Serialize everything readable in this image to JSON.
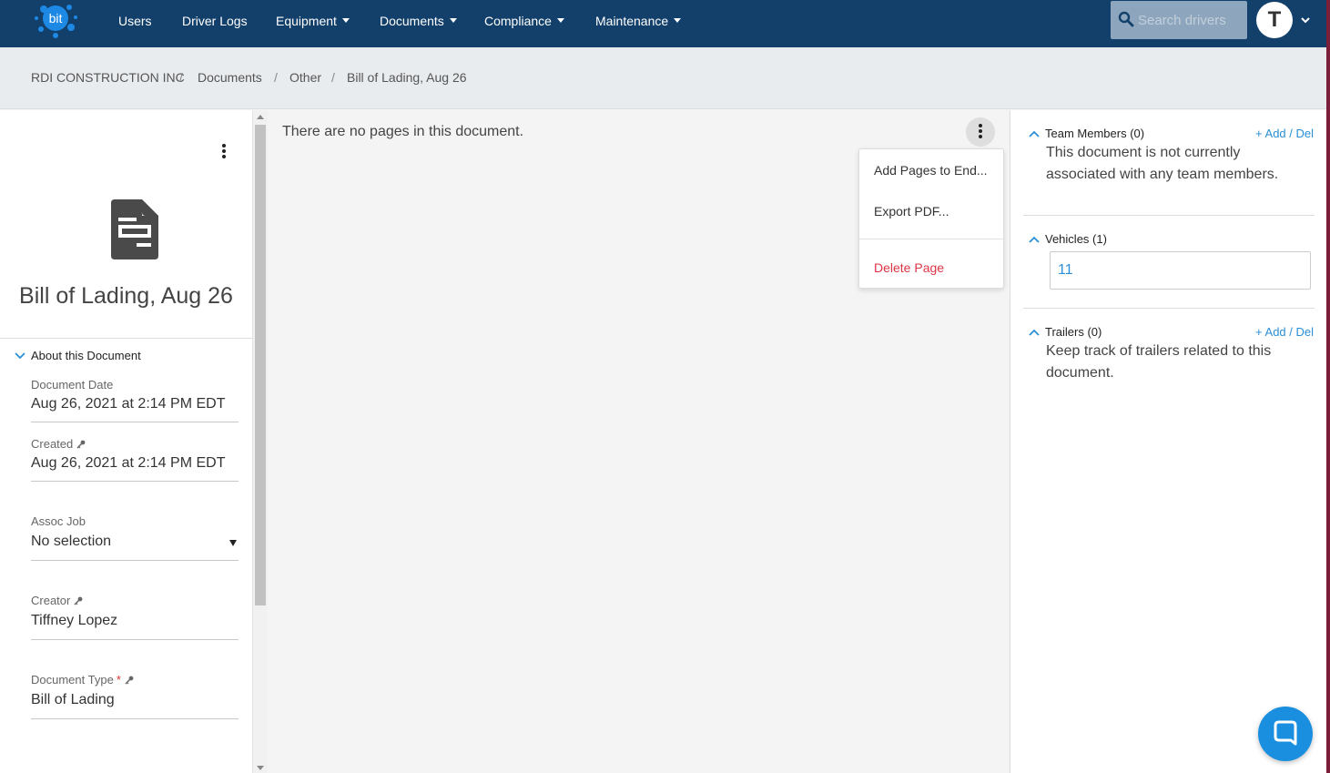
{
  "navbar": {
    "logo_text": "bit",
    "items": [
      {
        "label": "Users",
        "dropdown": false
      },
      {
        "label": "Driver Logs",
        "dropdown": false
      },
      {
        "label": "Equipment",
        "dropdown": true
      },
      {
        "label": "Documents",
        "dropdown": true
      },
      {
        "label": "Compliance",
        "dropdown": true
      },
      {
        "label": "Maintenance",
        "dropdown": true
      }
    ],
    "search_placeholder": "Search drivers",
    "avatar_initial": "T"
  },
  "breadcrumb": [
    "RDI CONSTRUCTION INC",
    "Documents",
    "Other",
    "Bill of Lading, Aug 26"
  ],
  "left_panel": {
    "title": "Bill of Lading, Aug 26",
    "section_label": "About this Document",
    "fields": {
      "document_date": {
        "label": "Document Date",
        "value": "Aug 26, 2021 at 2:14 PM EDT"
      },
      "created": {
        "label": "Created",
        "value": "Aug 26, 2021 at 2:14 PM EDT"
      },
      "assoc_job": {
        "label": "Assoc Job",
        "value": "No selection"
      },
      "creator": {
        "label": "Creator",
        "value": "Tiffney Lopez"
      },
      "document_type": {
        "label": "Document Type",
        "required_mark": "*",
        "value": "Bill of Lading"
      }
    }
  },
  "main": {
    "empty_message": "There are no pages in this document.",
    "menu": {
      "add_pages": "Add Pages to End...",
      "export_pdf": "Export PDF...",
      "delete_page": "Delete Page"
    }
  },
  "right_panel": {
    "team_members": {
      "title": "Team Members (0)",
      "action": "+ Add / Del",
      "text": "This document is not currently associated with any team members."
    },
    "vehicles": {
      "title": "Vehicles (1)",
      "items": [
        "11"
      ]
    },
    "trailers": {
      "title": "Trailers (0)",
      "action": "+ Add / Del",
      "text": "Keep track of trailers related to this document."
    }
  },
  "colors": {
    "navbar": "#12406b",
    "link": "#2b8fd6",
    "danger": "#dc3545",
    "chat": "#1a8fe0"
  },
  "icons": [
    "logo-splash-icon",
    "search-icon",
    "chevron-down-icon",
    "kebab-icon",
    "document-icon",
    "chevron-up-icon",
    "key-icon",
    "chat-icon"
  ]
}
